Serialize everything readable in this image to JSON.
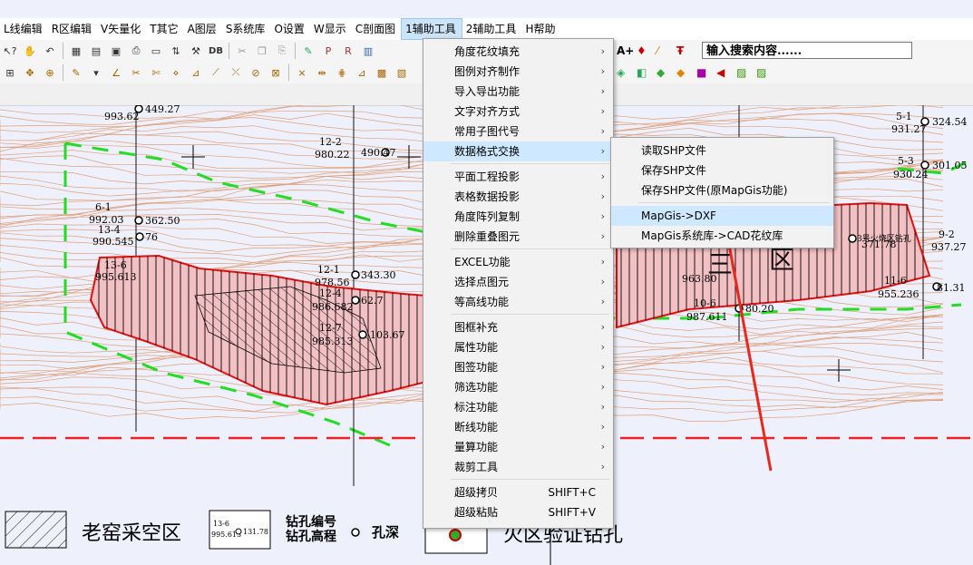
{
  "menubar": [
    {
      "label": "L线编辑",
      "active": false
    },
    {
      "label": "R区编辑",
      "active": false
    },
    {
      "label": "V矢量化",
      "active": false
    },
    {
      "label": "T其它",
      "active": false
    },
    {
      "label": "A图层",
      "active": false
    },
    {
      "label": "S系统库",
      "active": false
    },
    {
      "label": "O设置",
      "active": false
    },
    {
      "label": "W显示",
      "active": false
    },
    {
      "label": "C剖面图",
      "active": false
    },
    {
      "label": "1辅助工具",
      "active": true
    },
    {
      "label": "2辅助工具",
      "active": false
    },
    {
      "label": "H帮助",
      "active": false
    }
  ],
  "toolbar1": {
    "db_label": "DB",
    "font_label": "A+",
    "search_placeholder": "输入搜索内容......"
  },
  "aux_menu": {
    "items": [
      {
        "label": "角度花纹填充",
        "submenu": true
      },
      {
        "label": "图例对齐制作",
        "submenu": true
      },
      {
        "label": "导入导出功能",
        "submenu": true
      },
      {
        "label": "文字对齐方式",
        "submenu": true
      },
      {
        "label": "常用子图代号",
        "submenu": true
      },
      {
        "label": "数据格式交换",
        "submenu": true,
        "highlighted": true
      },
      {
        "sep": true
      },
      {
        "label": "平面工程投影",
        "submenu": true
      },
      {
        "label": "表格数据投影",
        "submenu": true
      },
      {
        "label": "角度阵列复制",
        "submenu": true
      },
      {
        "label": "删除重叠图元",
        "submenu": true
      },
      {
        "sep": true
      },
      {
        "label": "EXCEL功能",
        "submenu": true
      },
      {
        "label": "选择点图元",
        "submenu": true
      },
      {
        "label": "等高线功能",
        "submenu": true
      },
      {
        "sep": true
      },
      {
        "label": "图框补充",
        "submenu": true
      },
      {
        "label": "属性功能",
        "submenu": true
      },
      {
        "label": "图签功能",
        "submenu": true
      },
      {
        "label": "筛选功能",
        "submenu": true
      },
      {
        "label": "标注功能",
        "submenu": true
      },
      {
        "label": "断线功能",
        "submenu": true
      },
      {
        "label": "量算功能",
        "submenu": true
      },
      {
        "label": "裁剪工具",
        "submenu": true
      },
      {
        "sep": true
      },
      {
        "label": "超级拷贝",
        "shortcut": "SHIFT+C"
      },
      {
        "label": "超级粘贴",
        "shortcut": "SHIFT+V"
      }
    ]
  },
  "data_exchange_submenu": {
    "items": [
      {
        "label": "读取SHP文件"
      },
      {
        "label": "保存SHP文件"
      },
      {
        "label": "保存SHP文件(原MapGis功能)"
      },
      {
        "sep": true
      },
      {
        "label": "MapGis->DXF",
        "highlighted": true
      },
      {
        "label": "MapGis系统库->CAD花纹库"
      }
    ]
  },
  "map": {
    "labels": {
      "b1": "993.62",
      "b1p": "449.27",
      "b2": "12-2",
      "b2v": "980.22",
      "b2p": "490.47",
      "b3": "6-1",
      "b3v": "992.03",
      "b3a": "13-4",
      "b3b": "990.545",
      "p1": "362.50",
      "p2": "76",
      "b4": "13-6",
      "b4v": "995.613",
      "b5": "12-1",
      "b5v": "978.56",
      "b5a": "12-4",
      "b5b": "986.682",
      "b5p": "343.30",
      "b5q": "62.7",
      "b6": "12-7",
      "b6v": "985.313",
      "b6p": "103.67",
      "r1": "5-1",
      "r1v": "931.27",
      "r1p": "324.54",
      "r2": "5-3",
      "r2v": "930.24",
      "r2p": "301.05",
      "r3": "9-2",
      "r3v": "937.27",
      "r4": "10-6",
      "r4v": "987.611",
      "r4p": "80.20",
      "r5": "11-6",
      "r5v": "955.236",
      "r5p": "81.31",
      "r6": "963.80",
      "zone_a": "三",
      "zone_b": "区",
      "burn_label": "3号火烧区钻孔",
      "burn_label2": "371.78"
    }
  },
  "legend": {
    "old_mine": "老窑采空区",
    "sample_a": "13-6",
    "sample_b": "995.613",
    "sample_c": "131.78",
    "drill_number": "钻孔编号",
    "drill_elev": "钻孔高程",
    "hole_depth": "孔深",
    "burn_verify": "火区验证钻孔"
  }
}
